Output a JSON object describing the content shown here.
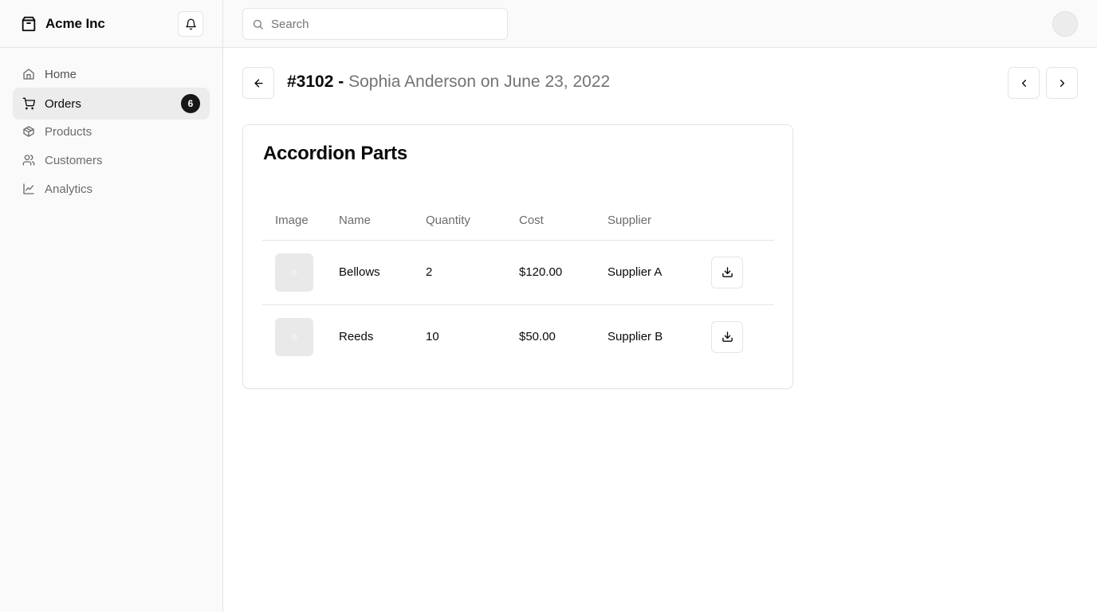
{
  "brand": {
    "name": "Acme Inc",
    "icon": "package-icon"
  },
  "notifications": {
    "icon": "bell-icon"
  },
  "sidebar": {
    "items": [
      {
        "label": "Home",
        "icon": "home-icon"
      },
      {
        "label": "Orders",
        "icon": "cart-icon",
        "badge": "6",
        "active": true
      },
      {
        "label": "Products",
        "icon": "package-icon"
      },
      {
        "label": "Customers",
        "icon": "users-icon"
      },
      {
        "label": "Analytics",
        "icon": "line-chart-icon"
      }
    ]
  },
  "search": {
    "placeholder": "Search",
    "value": ""
  },
  "order": {
    "id": "#3102 -",
    "subtitle": "Sophia Anderson on June 23, 2022",
    "back_icon": "arrow-left-icon",
    "prev_icon": "chevron-left-icon",
    "next_icon": "chevron-right-icon"
  },
  "card": {
    "title": "Accordion Parts",
    "columns": [
      "Image",
      "Name",
      "Quantity",
      "Cost",
      "Supplier"
    ],
    "rows": [
      {
        "name": "Bellows",
        "quantity": "2",
        "cost": "$120.00",
        "supplier": "Supplier A"
      },
      {
        "name": "Reeds",
        "quantity": "10",
        "cost": "$50.00",
        "supplier": "Supplier B"
      }
    ],
    "download_icon": "download-icon"
  },
  "colors": {
    "accent": "#171717",
    "muted": "#737373",
    "border": "#e5e5e5",
    "sidebar_bg": "#fafafa"
  }
}
